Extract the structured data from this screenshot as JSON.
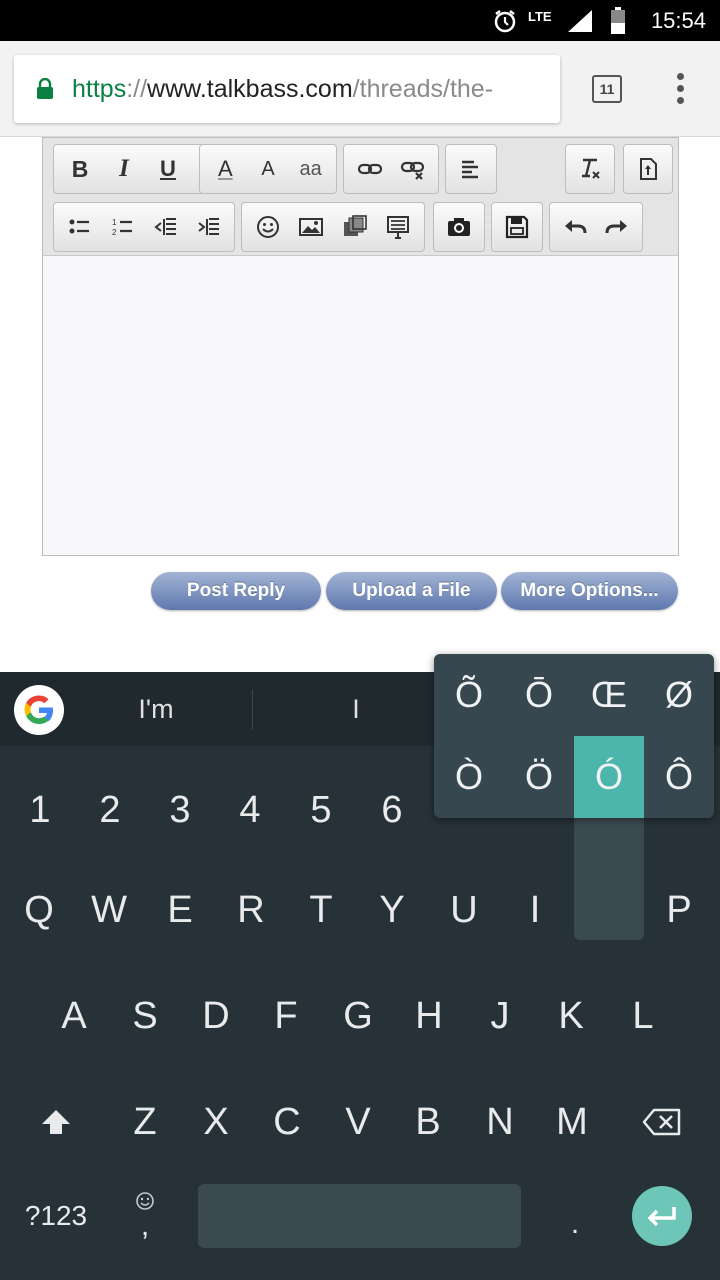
{
  "status_bar": {
    "network": "LTE",
    "time": "15:54"
  },
  "browser": {
    "url_scheme": "https",
    "url_sep": "://",
    "url_host": "www.talkbass.com",
    "url_path": "/threads/the-",
    "tab_count": "11"
  },
  "editor": {
    "toolbar_row1": [
      "bold",
      "italic",
      "underline",
      "font-color",
      "font-size",
      "text-case",
      "link",
      "unlink",
      "align",
      "remove-format",
      "switch-mode"
    ],
    "toolbar_row2": [
      "bulleted-list",
      "numbered-list",
      "outdent",
      "indent",
      "smilies",
      "image",
      "media",
      "insert-block",
      "camera",
      "save-draft",
      "undo",
      "redo"
    ],
    "labels": {
      "bold": "B",
      "italic": "I",
      "underline": "U",
      "font_color": "A",
      "font_size": "A",
      "text_case": "aa"
    }
  },
  "actions": {
    "post_reply": "Post Reply",
    "upload_file": "Upload a File",
    "more_options": "More Options..."
  },
  "keyboard": {
    "suggestions": [
      "I'm",
      "I"
    ],
    "numbers": [
      "1",
      "2",
      "3",
      "4",
      "5",
      "6"
    ],
    "row_qwerty": [
      "Q",
      "W",
      "E",
      "R",
      "T",
      "Y",
      "U",
      "I",
      "P"
    ],
    "row_asdf": [
      "A",
      "S",
      "D",
      "F",
      "G",
      "H",
      "J",
      "K",
      "L"
    ],
    "row_zxcv": [
      "Z",
      "X",
      "C",
      "V",
      "B",
      "N",
      "M"
    ],
    "symbols_key": "?123",
    "comma_key": ",",
    "period_key": ".",
    "accent_popup": [
      "Õ",
      "Ō",
      "Œ",
      "Ø",
      "Ò",
      "Ö",
      "Ó",
      "Ô"
    ],
    "accent_selected": "Ó"
  }
}
